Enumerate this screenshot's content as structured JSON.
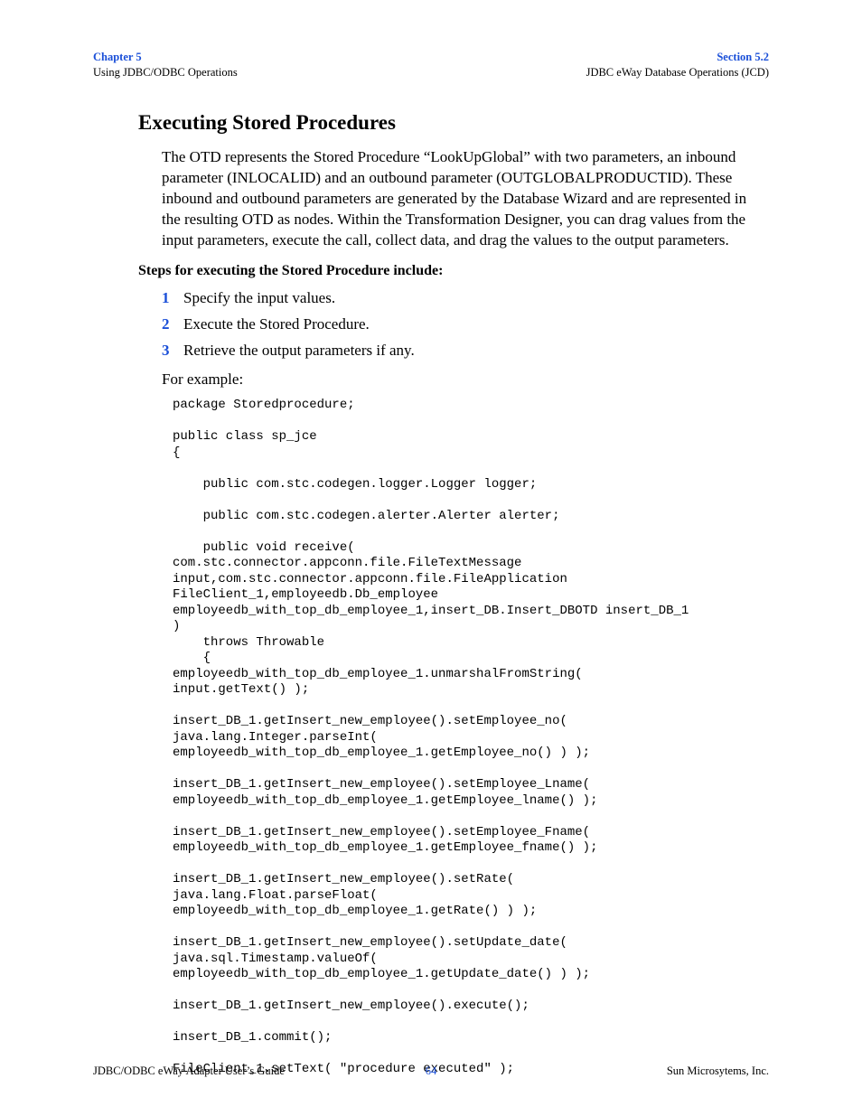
{
  "header": {
    "chapter_label": "Chapter 5",
    "chapter_sub": "Using JDBC/ODBC Operations",
    "section_label": "Section 5.2",
    "section_sub": "JDBC eWay Database Operations (JCD)"
  },
  "section_title": "Executing Stored Procedures",
  "intro_para": "The OTD represents the Stored Procedure “LookUpGlobal” with two parameters, an inbound parameter (INLOCALID) and an outbound parameter (OUTGLOBALPRODUCTID). These inbound and outbound parameters are generated by the Database Wizard and are represented in the resulting OTD as nodes. Within the Transformation Designer, you can drag values from the input parameters, execute the call, collect data, and drag the values to the output parameters.",
  "steps_heading": "Steps for executing the Stored Procedure include:",
  "steps": [
    {
      "num": "1",
      "text": "Specify the input values."
    },
    {
      "num": "2",
      "text": "Execute the Stored Procedure."
    },
    {
      "num": "3",
      "text": "Retrieve the output parameters if any."
    }
  ],
  "example_lead": "For example:",
  "code": "package Storedprocedure;\n\npublic class sp_jce\n{\n\n    public com.stc.codegen.logger.Logger logger;\n\n    public com.stc.codegen.alerter.Alerter alerter;\n\n    public void receive( \ncom.stc.connector.appconn.file.FileTextMessage \ninput,com.stc.connector.appconn.file.FileApplication \nFileClient_1,employeedb.Db_employee \nemployeedb_with_top_db_employee_1,insert_DB.Insert_DBOTD insert_DB_1 \n)\n    throws Throwable\n    {\nemployeedb_with_top_db_employee_1.unmarshalFromString( \ninput.getText() );\n\ninsert_DB_1.getInsert_new_employee().setEmployee_no( \njava.lang.Integer.parseInt( \nemployeedb_with_top_db_employee_1.getEmployee_no() ) );\n\ninsert_DB_1.getInsert_new_employee().setEmployee_Lname( \nemployeedb_with_top_db_employee_1.getEmployee_lname() );\n\ninsert_DB_1.getInsert_new_employee().setEmployee_Fname( \nemployeedb_with_top_db_employee_1.getEmployee_fname() );\n\ninsert_DB_1.getInsert_new_employee().setRate( \njava.lang.Float.parseFloat( \nemployeedb_with_top_db_employee_1.getRate() ) );\n\ninsert_DB_1.getInsert_new_employee().setUpdate_date( \njava.sql.Timestamp.valueOf( \nemployeedb_with_top_db_employee_1.getUpdate_date() ) );\n\ninsert_DB_1.getInsert_new_employee().execute();\n\ninsert_DB_1.commit();\n\nFileClient_1.setText( \"procedure executed\" );",
  "footer": {
    "left": "JDBC/ODBC eWay Adapter User’s Guide",
    "center": "64",
    "right": "Sun Microsytems, Inc."
  }
}
